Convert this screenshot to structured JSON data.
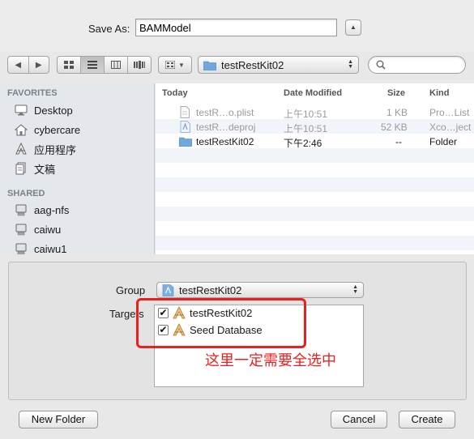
{
  "header": {
    "save_as_label": "Save As:",
    "save_as_value": "BAMModel"
  },
  "toolbar": {
    "location": "testRestKit02",
    "search_placeholder": ""
  },
  "sidebar": {
    "favorites_heading": "FAVORITES",
    "favorites": [
      {
        "label": "Desktop",
        "icon": "desktop-icon"
      },
      {
        "label": "cybercare",
        "icon": "home-icon"
      },
      {
        "label": "应用程序",
        "icon": "applications-icon"
      },
      {
        "label": "文稿",
        "icon": "documents-icon"
      }
    ],
    "shared_heading": "SHARED",
    "shared": [
      {
        "label": "aag-nfs",
        "icon": "computer-icon"
      },
      {
        "label": "caiwu",
        "icon": "computer-icon"
      },
      {
        "label": "caiwu1",
        "icon": "computer-icon"
      }
    ]
  },
  "filelist": {
    "columns": {
      "name": "Today",
      "date": "Date Modified",
      "size": "Size",
      "kind": "Kind"
    },
    "rows": [
      {
        "name": "testR…o.plist",
        "date": "上午10:51",
        "size": "1 KB",
        "kind": "Pro…List",
        "icon": "plist-file-icon",
        "dimmed": true
      },
      {
        "name": "testR…deproj",
        "date": "上午10:51",
        "size": "52 KB",
        "kind": "Xco…ject",
        "icon": "xcodeproj-file-icon",
        "dimmed": true
      },
      {
        "name": "testRestKit02",
        "date": "下午2:46",
        "size": "--",
        "kind": "Folder",
        "icon": "folder-icon",
        "dimmed": false
      }
    ]
  },
  "options": {
    "group_label": "Group",
    "group_value": "testRestKit02",
    "targets_label": "Targets",
    "targets": [
      {
        "label": "testRestKit02",
        "checked": true
      },
      {
        "label": "Seed Database",
        "checked": true
      }
    ],
    "annotation": "这里一定需要全选中"
  },
  "buttons": {
    "new_folder": "New Folder",
    "cancel": "Cancel",
    "create": "Create"
  },
  "colors": {
    "annotation": "#e8201f",
    "sidebar_bg": "#e4e8ed",
    "folder_blue": "#6ea8dc"
  }
}
